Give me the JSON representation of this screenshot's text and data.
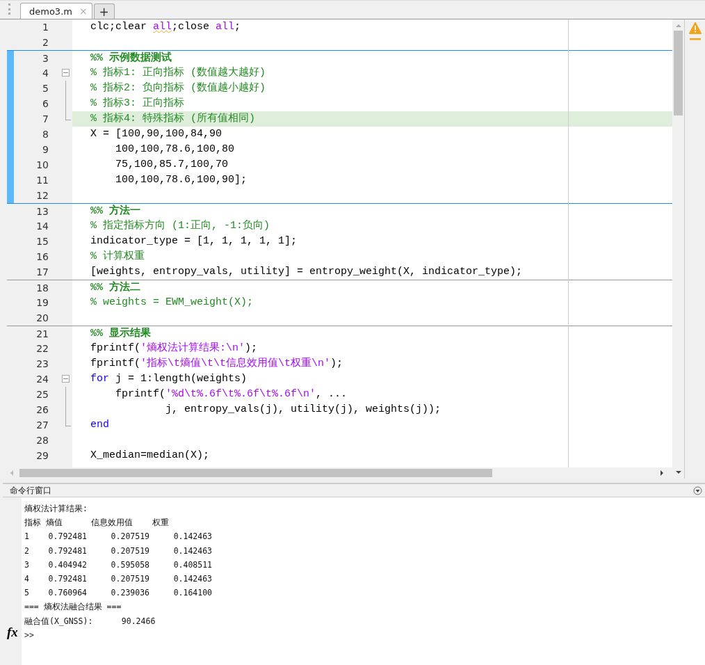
{
  "tabs": [
    {
      "label": "demo3.m",
      "close": "×",
      "selected": true
    }
  ],
  "new_tab": "+",
  "lines": [
    {
      "no": "1",
      "tokens": [
        {
          "text": "clc;clear ",
          "kind": "plain"
        },
        {
          "text": "all",
          "kind": "string",
          "warning": true
        },
        {
          "text": ";close ",
          "kind": "plain"
        },
        {
          "text": "all",
          "kind": "string"
        },
        {
          "text": ";",
          "kind": "plain"
        }
      ]
    },
    {
      "no": "2"
    },
    {
      "no": "3",
      "active": true,
      "cell_break": true,
      "tokens": [
        {
          "text": "%% 示例数据测试",
          "kind": "cell_title"
        }
      ]
    },
    {
      "no": "4",
      "active": true,
      "fold_toggle": true,
      "tokens": [
        {
          "text": "% 指标1: 正向指标 (数值越大越好)",
          "kind": "comment"
        }
      ]
    },
    {
      "no": "5",
      "active": true,
      "folded_region": true,
      "tokens": [
        {
          "text": "% 指标2: 负向指标 (数值越小越好)",
          "kind": "comment"
        }
      ]
    },
    {
      "no": "6",
      "active": true,
      "folded_region": true,
      "tokens": [
        {
          "text": "% 指标3: 正向指标",
          "kind": "comment"
        }
      ]
    },
    {
      "no": "7",
      "active": true,
      "folded_region": true,
      "highlighted": true,
      "tokens": [
        {
          "text": "% 指标4: 特殊指标 (所有值相同)",
          "kind": "comment"
        }
      ]
    },
    {
      "no": "8",
      "active": true,
      "tokens": [
        {
          "text": "X = [100,90,100,84,90",
          "kind": "plain"
        }
      ]
    },
    {
      "no": "9",
      "active": true,
      "tokens": [
        {
          "text": "    100,100,78.6,100,80",
          "kind": "plain"
        }
      ]
    },
    {
      "no": "10",
      "active": true,
      "tokens": [
        {
          "text": "    75,100,85.7,100,70",
          "kind": "plain"
        }
      ]
    },
    {
      "no": "11",
      "active": true,
      "tokens": [
        {
          "text": "    100,100,78.6,100,90];",
          "kind": "plain"
        }
      ]
    },
    {
      "no": "12",
      "active": true
    },
    {
      "no": "13",
      "cell_break": true,
      "tokens": [
        {
          "text": "%% 方法一",
          "kind": "cell_title"
        }
      ]
    },
    {
      "no": "14",
      "tokens": [
        {
          "text": "% 指定指标方向 (1:正向, -1:负向)",
          "kind": "comment"
        }
      ]
    },
    {
      "no": "15",
      "tokens": [
        {
          "text": "indicator_type = [1, 1, 1, 1, 1];",
          "kind": "plain"
        }
      ]
    },
    {
      "no": "16",
      "tokens": [
        {
          "text": "% 计算权重",
          "kind": "comment"
        }
      ]
    },
    {
      "no": "17",
      "tokens": [
        {
          "text": "[weights, entropy_vals, utility] = entropy_weight(X, indicator_type);",
          "kind": "plain"
        }
      ]
    },
    {
      "no": "18",
      "cell_break": true,
      "tokens": [
        {
          "text": "%% 方法二",
          "kind": "cell_title"
        }
      ]
    },
    {
      "no": "19",
      "tokens": [
        {
          "text": "% weights = EWM_weight(X);",
          "kind": "comment"
        }
      ]
    },
    {
      "no": "20"
    },
    {
      "no": "21",
      "cell_break": true,
      "tokens": [
        {
          "text": "%% 显示结果",
          "kind": "cell_title"
        }
      ]
    },
    {
      "no": "22",
      "tokens": [
        {
          "text": "fprintf(",
          "kind": "plain"
        },
        {
          "text": "'熵权法计算结果:\\n'",
          "kind": "string"
        },
        {
          "text": ");",
          "kind": "plain"
        }
      ]
    },
    {
      "no": "23",
      "tokens": [
        {
          "text": "fprintf(",
          "kind": "plain"
        },
        {
          "text": "'指标\\t熵值\\t\\t信息效用值\\t权重\\n'",
          "kind": "string"
        },
        {
          "text": ");",
          "kind": "plain"
        }
      ]
    },
    {
      "no": "24",
      "fold_toggle": true,
      "tokens": [
        {
          "text": "for",
          "kind": "keyword"
        },
        {
          "text": " j = 1:length(weights)",
          "kind": "plain"
        }
      ]
    },
    {
      "no": "25",
      "folded_region": true,
      "tokens": [
        {
          "text": "    fprintf(",
          "kind": "plain"
        },
        {
          "text": "'%d\\t%.6f\\t%.6f\\t%.6f\\n'",
          "kind": "string"
        },
        {
          "text": ", ...",
          "kind": "plain"
        }
      ]
    },
    {
      "no": "26",
      "folded_region": true,
      "tokens": [
        {
          "text": "            j, entropy_vals(j), utility(j), weights(j));",
          "kind": "plain"
        }
      ]
    },
    {
      "no": "27",
      "folded_region": true,
      "tokens": [
        {
          "text": "end",
          "kind": "keyword"
        }
      ]
    },
    {
      "no": "28"
    },
    {
      "no": "29",
      "tokens": [
        {
          "text": "X_median=median(X);",
          "kind": "plain"
        }
      ]
    }
  ],
  "command_window": {
    "title": "命令行窗口",
    "output": [
      "熵权法计算结果:",
      "指标 熵值      信息效用值    权重",
      "1    0.792481     0.207519     0.142463",
      "2    0.792481     0.207519     0.142463",
      "3    0.404942     0.595058     0.408511",
      "4    0.792481     0.207519     0.142463",
      "5    0.760964     0.239036     0.164100",
      "=== 熵权法融合结果 ===",
      "融合值(X_GNSS):      90.2466"
    ],
    "fx": "fx",
    "prompt": ">>"
  }
}
